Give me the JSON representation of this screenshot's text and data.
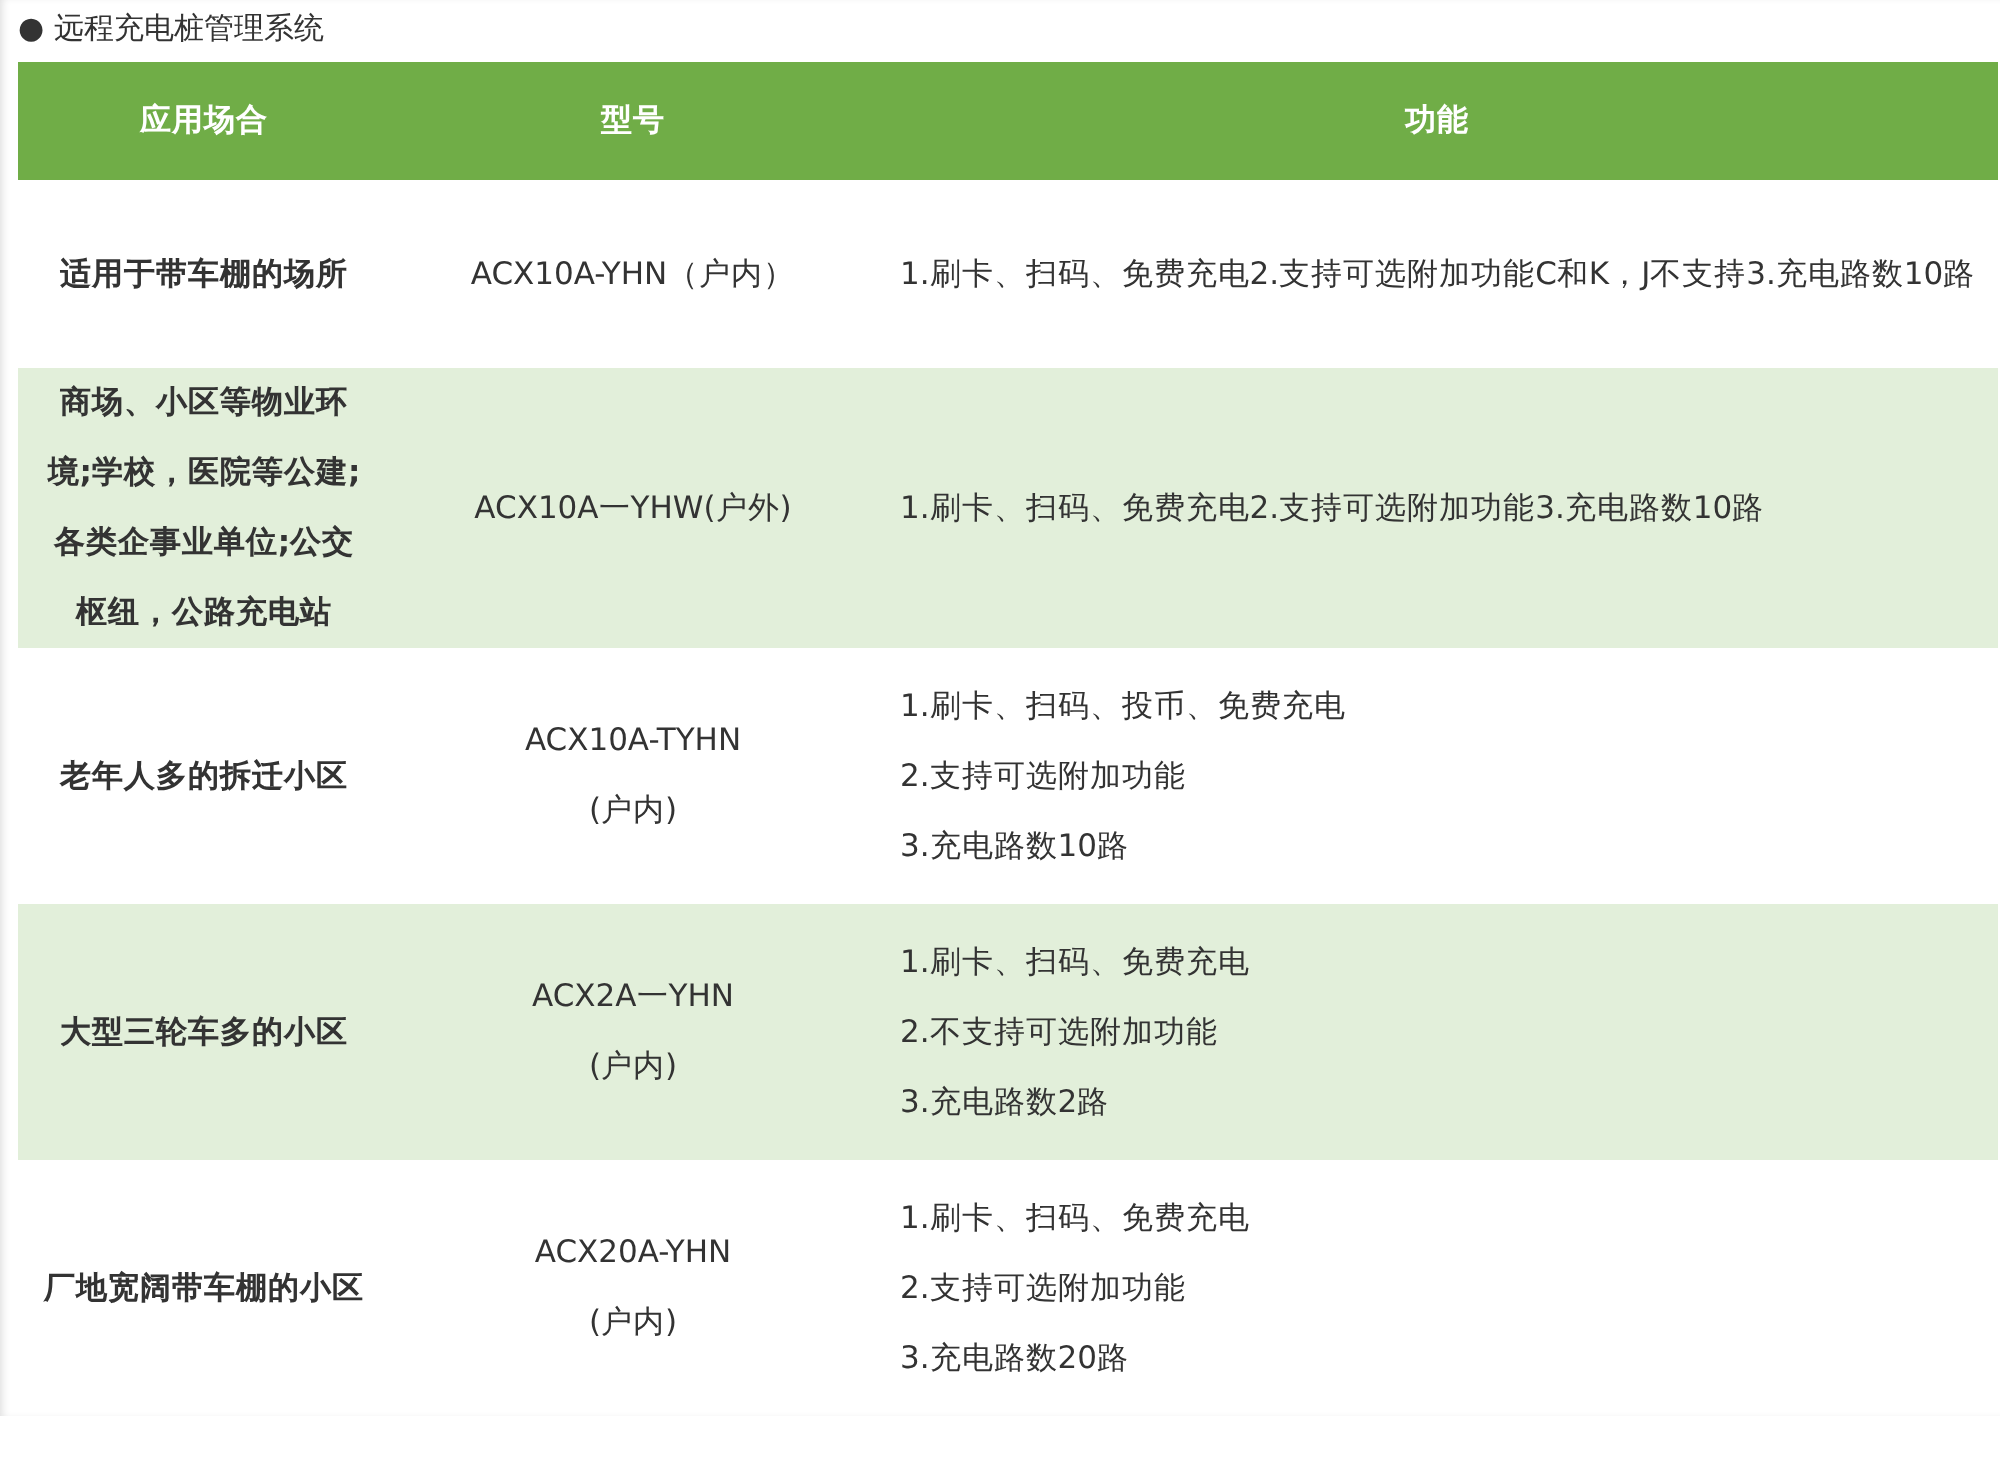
{
  "title": "● 远程充电桩管理系统",
  "table": {
    "columns": [
      "应用场合",
      "型号",
      "功能"
    ],
    "rows": [
      {
        "scenario": "适用于带车棚的场所",
        "model": [
          "ACX10A-YHN（户内）"
        ],
        "features": [
          "1.刷卡、扫码、免费充电2.支持可选附加功能C和K，J不支持3.充电路数10路"
        ]
      },
      {
        "scenario": "商场、小区等物业环境;学校，医院等公建;各类企事业单位;公交枢纽，公路充电站",
        "model": [
          "ACX10A一YHW(户外)"
        ],
        "features": [
          "1.刷卡、扫码、免费充电2.支持可选附加功能3.充电路数10路"
        ]
      },
      {
        "scenario": "老年人多的拆迁小区",
        "model": [
          "ACX10A-TYHN",
          "(户内)"
        ],
        "features": [
          "1.刷卡、扫码、投币、免费充电",
          "2.支持可选附加功能",
          "3.充电路数10路"
        ]
      },
      {
        "scenario": "大型三轮车多的小区",
        "model": [
          "ACX2A一YHN",
          "(户内)"
        ],
        "features": [
          "1.刷卡、扫码、免费充电",
          "2.不支持可选附加功能",
          "3.充电路数2路"
        ]
      },
      {
        "scenario": "厂地宽阔带车棚的小区",
        "model": [
          "ACX20A-YHN",
          "(户内)"
        ],
        "features": [
          "1.刷卡、扫码、免费充电",
          "2.支持可选附加功能",
          "3.充电路数20路"
        ]
      }
    ]
  }
}
